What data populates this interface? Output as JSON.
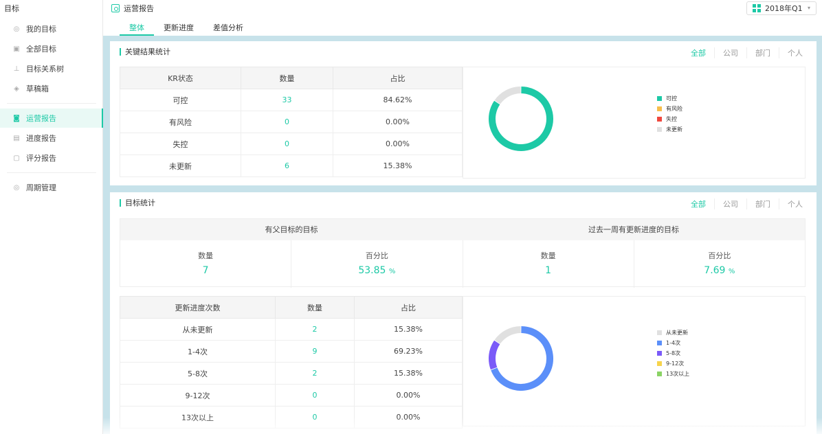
{
  "sidebar": {
    "title": "目标",
    "items": [
      {
        "label": "我的目标",
        "icon": "target-icon",
        "active": false
      },
      {
        "label": "全部目标",
        "icon": "chart-icon",
        "active": false
      },
      {
        "label": "目标关系树",
        "icon": "tree-icon",
        "active": false
      },
      {
        "label": "草稿箱",
        "icon": "box-icon",
        "active": false
      },
      {
        "label": "运营报告",
        "icon": "report-icon",
        "active": true
      },
      {
        "label": "进度报告",
        "icon": "progress-icon",
        "active": false
      },
      {
        "label": "评分报告",
        "icon": "score-icon",
        "active": false
      },
      {
        "label": "周期管理",
        "icon": "cycle-icon",
        "active": false
      }
    ]
  },
  "header": {
    "title": "运营报告",
    "tabs": [
      {
        "label": "整体",
        "active": true
      },
      {
        "label": "更新进度",
        "active": false
      },
      {
        "label": "差值分析",
        "active": false
      }
    ],
    "quarter": "2018年Q1"
  },
  "filters": [
    "全部",
    "公司",
    "部门",
    "个人"
  ],
  "colors": {
    "accent": "#1dc9a6",
    "kr_chart": [
      "#1dc9a6",
      "#f7be4c",
      "#f0483e",
      "#e0e0e0"
    ],
    "progress_chart": [
      "#e0e0e0",
      "#5b8ff9",
      "#7a5af8",
      "#f7d44c",
      "#8ad365"
    ]
  },
  "kr_card": {
    "title": "关键结果统计",
    "columns": [
      "KR状态",
      "数量",
      "占比"
    ],
    "rows": [
      {
        "status": "可控",
        "count": "33",
        "percent": "84.62%"
      },
      {
        "status": "有风险",
        "count": "0",
        "percent": "0.00%"
      },
      {
        "status": "失控",
        "count": "0",
        "percent": "0.00%"
      },
      {
        "status": "未更新",
        "count": "6",
        "percent": "15.38%"
      }
    ],
    "legend": [
      "可控",
      "有风险",
      "失控",
      "未更新"
    ]
  },
  "goal_card": {
    "title": "目标统计",
    "groups": [
      {
        "title": "有父目标的目标",
        "count_label": "数量",
        "count": "7",
        "pct_label": "百分比",
        "pct": "53.85",
        "pct_unit": "%"
      },
      {
        "title": "过去一周有更新进度的目标",
        "count_label": "数量",
        "count": "1",
        "pct_label": "百分比",
        "pct": "7.69",
        "pct_unit": "%"
      }
    ],
    "progress_columns": [
      "更新进度次数",
      "数量",
      "占比"
    ],
    "progress_rows": [
      {
        "label": "从未更新",
        "count": "2",
        "percent": "15.38%"
      },
      {
        "label": "1-4次",
        "count": "9",
        "percent": "69.23%"
      },
      {
        "label": "5-8次",
        "count": "2",
        "percent": "15.38%"
      },
      {
        "label": "9-12次",
        "count": "0",
        "percent": "0.00%"
      },
      {
        "label": "13次以上",
        "count": "0",
        "percent": "0.00%"
      }
    ],
    "legend": [
      "从未更新",
      "1-4次",
      "5-8次",
      "9-12次",
      "13次以上"
    ]
  },
  "chart_data": [
    {
      "type": "pie",
      "categories": [
        "可控",
        "有风险",
        "失控",
        "未更新"
      ],
      "values": [
        33,
        0,
        0,
        6
      ],
      "legend": "right"
    },
    {
      "type": "pie",
      "categories": [
        "从未更新",
        "1-4次",
        "5-8次",
        "9-12次",
        "13次以上"
      ],
      "values": [
        2,
        9,
        2,
        0,
        0
      ],
      "legend": "right"
    }
  ]
}
